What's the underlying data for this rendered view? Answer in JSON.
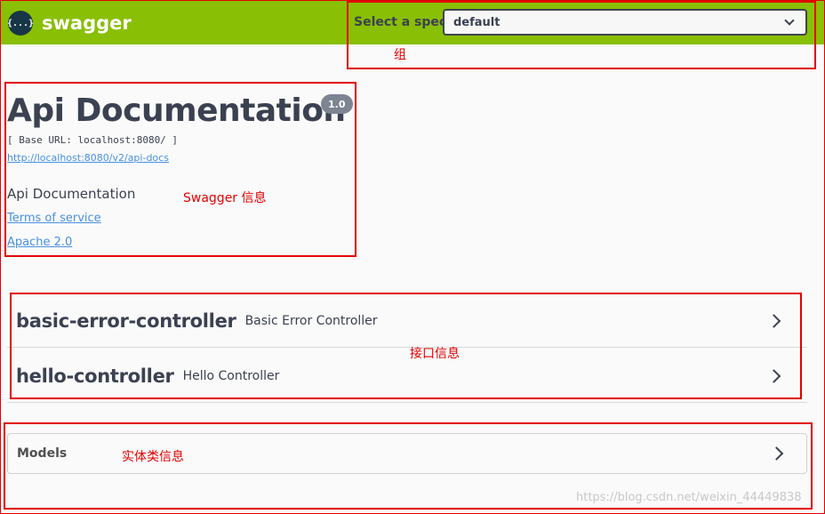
{
  "topbar": {
    "logo_glyph": "{...}",
    "brand": "swagger",
    "spec_label": "Select a spec",
    "spec_selected": "default",
    "bg_color": "#89bf04"
  },
  "info": {
    "title": "Api Documentation",
    "version": "1.0",
    "base_url": "[ Base URL: localhost:8080/ ]",
    "docs_url": "http://localhost:8080/v2/api-docs",
    "description": "Api Documentation",
    "terms_link": "Terms of service",
    "license_link": "Apache 2.0"
  },
  "tags": [
    {
      "name": "basic-error-controller",
      "description": "Basic Error Controller"
    },
    {
      "name": "hello-controller",
      "description": "Hello Controller"
    }
  ],
  "models": {
    "label": "Models"
  },
  "annotations": {
    "group": "组",
    "swagger_info": "Swagger 信息",
    "api_info": "接口信息",
    "entity_info": "实体类信息",
    "color": "#e00000"
  },
  "watermark": "https://blog.csdn.net/weixin_44449838"
}
